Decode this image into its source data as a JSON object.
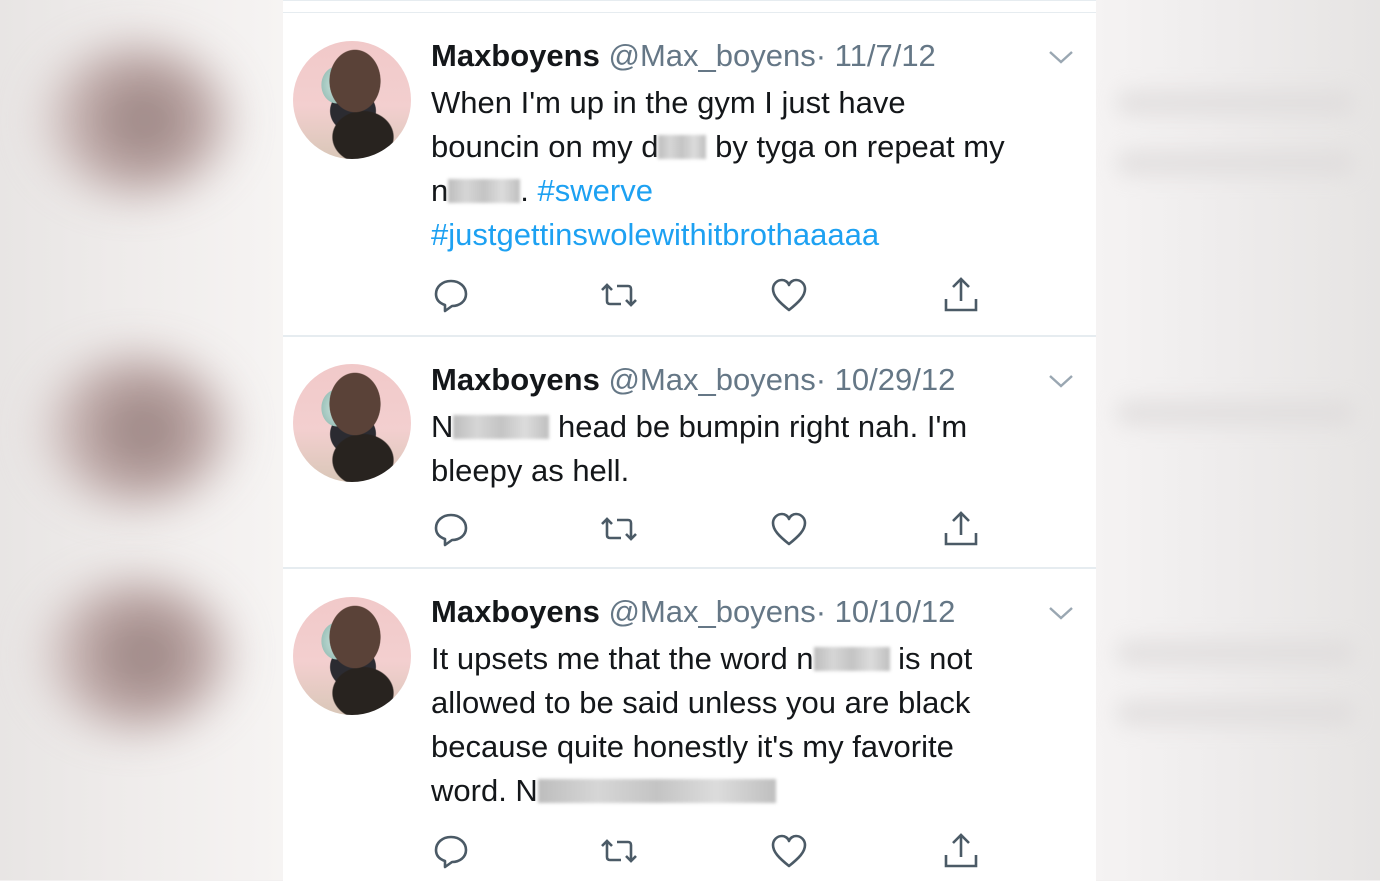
{
  "tweets": [
    {
      "name": "Maxboyens",
      "handle": "@Max_boyens",
      "separator": "·",
      "date": "11/7/12",
      "text": {
        "l1": "When I'm up in the gym I just have",
        "l2a": "bouncin on my d",
        "l2b": " by tyga on repeat my",
        "l3a": "n",
        "l3b": ".",
        "hashtag1": "#swerve",
        "hashtag2": "#justgettinswolewithitbrothaaaaa"
      }
    },
    {
      "name": "Maxboyens",
      "handle": "@Max_boyens",
      "separator": "·",
      "date": "10/29/12",
      "text": {
        "l1a": "N",
        "l1b": " head be bumpin right nah. I'm",
        "l2": "bleepy as hell."
      }
    },
    {
      "name": "Maxboyens",
      "handle": "@Max_boyens",
      "separator": "·",
      "date": "10/10/12",
      "text": {
        "l1a": "It upsets me that the word ",
        "l1b": "n",
        "l1c": " is not",
        "l2": "allowed to be said unless you are black",
        "l3": "because quite honestly it's my favorite",
        "l4": "word. N"
      }
    }
  ],
  "icons": [
    "reply-icon",
    "retweet-icon",
    "like-icon",
    "share-icon",
    "chevron-down-icon"
  ],
  "colors": {
    "link": "#1da1f2",
    "muted": "#657786",
    "text": "#14171a"
  }
}
